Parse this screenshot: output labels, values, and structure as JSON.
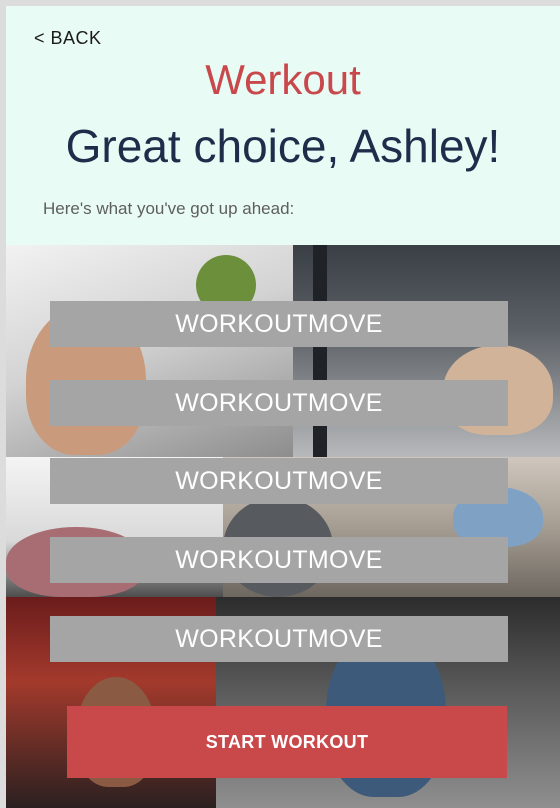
{
  "nav": {
    "back_label": "< BACK"
  },
  "brand": {
    "name": "Werkout",
    "color": "#c9484b"
  },
  "header": {
    "greeting": "Great choice, Ashley!",
    "subtitle": "Here's what you've got up ahead:"
  },
  "workout": {
    "moves": [
      {
        "label": "WORKOUTMOVE"
      },
      {
        "label": "WORKOUTMOVE"
      },
      {
        "label": "WORKOUTMOVE"
      },
      {
        "label": "WORKOUTMOVE"
      },
      {
        "label": "WORKOUTMOVE"
      }
    ],
    "start_label": "START WORKOUT"
  },
  "colors": {
    "background": "#e9fbf5",
    "title": "#1f2d4a",
    "move_bar": "#a5a5a5",
    "start_button": "#c9484a"
  }
}
